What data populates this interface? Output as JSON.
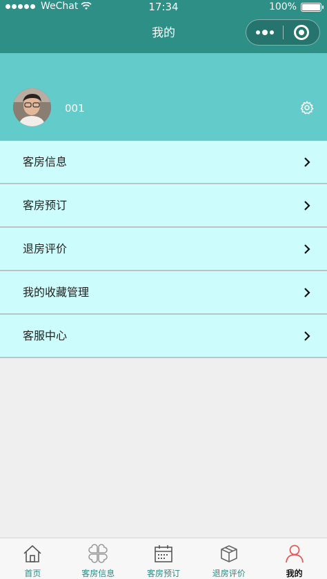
{
  "status_bar": {
    "carrier": "WeChat",
    "time": "17:34",
    "battery": "100%"
  },
  "nav": {
    "title": "我的"
  },
  "profile": {
    "username": "001"
  },
  "menu": {
    "items": [
      {
        "label": "客房信息"
      },
      {
        "label": "客房预订"
      },
      {
        "label": "退房评价"
      },
      {
        "label": "我的收藏管理"
      },
      {
        "label": "客服中心"
      }
    ]
  },
  "tabbar": {
    "items": [
      {
        "label": "首页",
        "icon": "home-icon"
      },
      {
        "label": "客房信息",
        "icon": "clover-icon"
      },
      {
        "label": "客房预订",
        "icon": "calendar-icon"
      },
      {
        "label": "退房评价",
        "icon": "box-icon"
      },
      {
        "label": "我的",
        "icon": "user-icon"
      }
    ],
    "active_index": 4
  },
  "colors": {
    "nav_bg": "#2e8f87",
    "profile_bg": "#63cbc9",
    "menu_bg": "#ccfcfb",
    "tab_inactive": "#2a8d86",
    "tab_active_icon": "#e25a5a"
  }
}
